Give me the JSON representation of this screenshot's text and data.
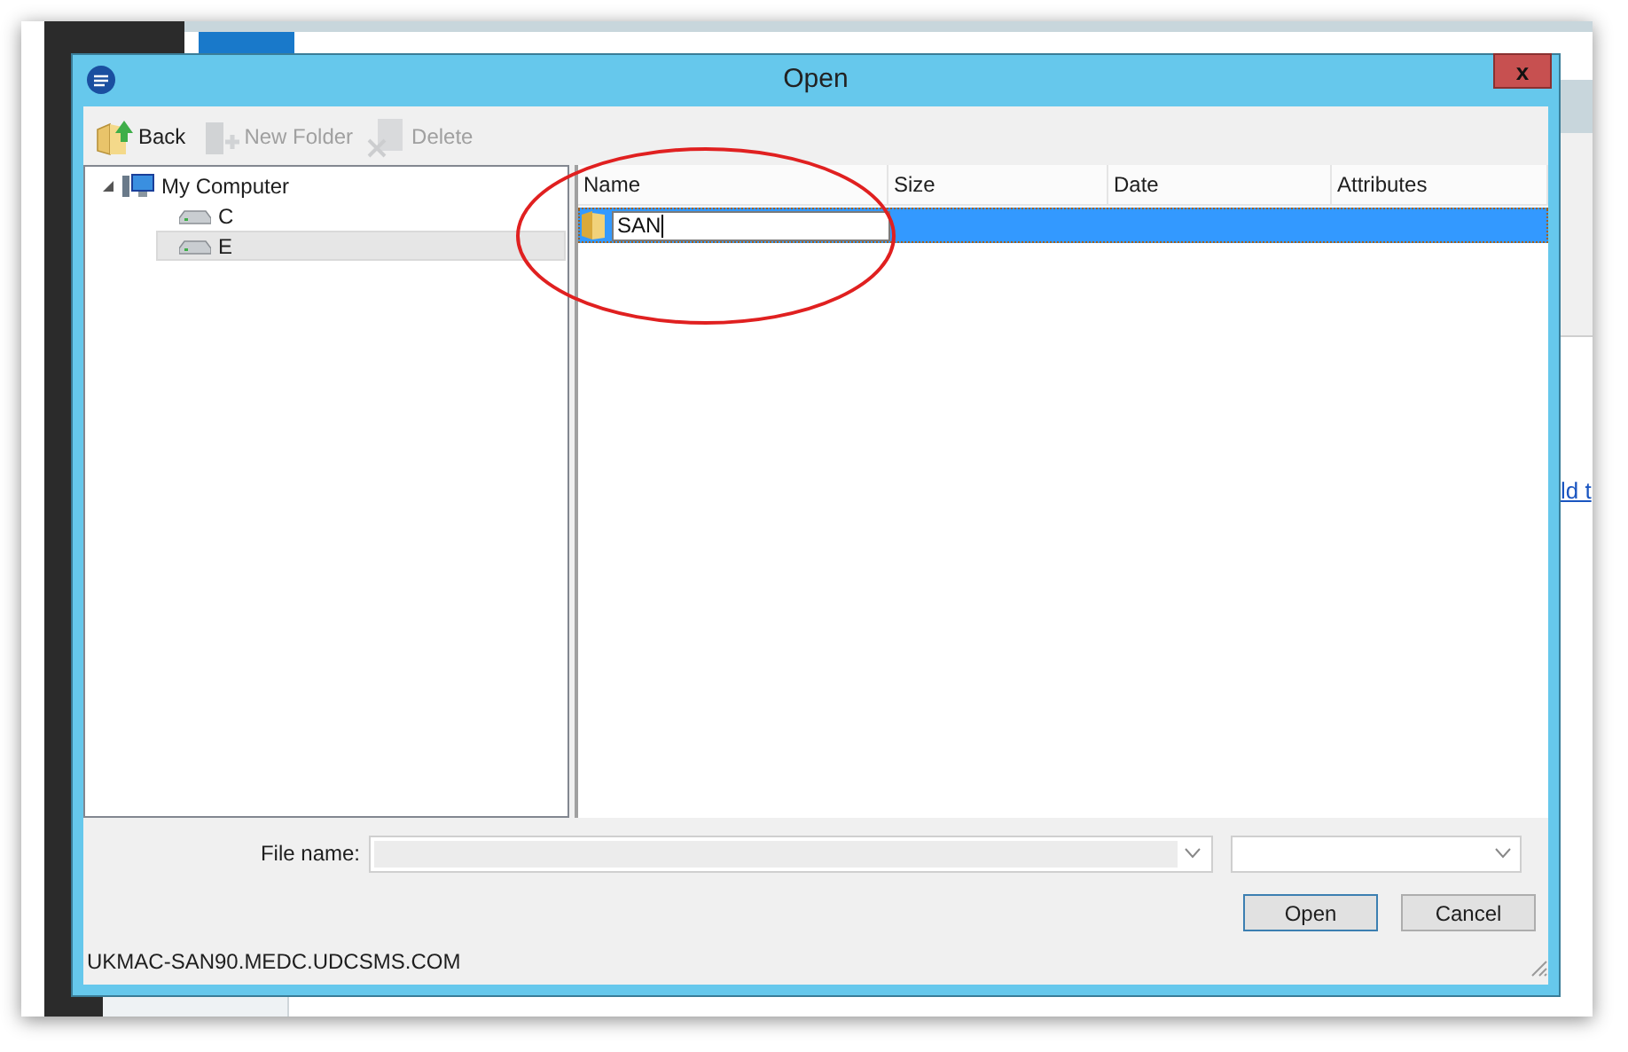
{
  "background": {
    "link": "ld t"
  },
  "dialog": {
    "title": "Open",
    "close_label": "x",
    "toolbar": [
      {
        "kind": "back",
        "label": "Back",
        "disabled": false
      },
      {
        "kind": "new-folder",
        "label": "New Folder",
        "disabled": true
      },
      {
        "kind": "delete",
        "label": "Delete",
        "disabled": true
      }
    ],
    "tree": [
      {
        "kind": "computer",
        "label": "My Computer",
        "expanded": true,
        "selected": false,
        "children": [
          {
            "kind": "drive",
            "label": "C",
            "selected": false
          },
          {
            "kind": "drive",
            "label": "E",
            "selected": true
          }
        ]
      }
    ],
    "columns": [
      "Name",
      "Size",
      "Date",
      "Attributes"
    ],
    "rows": [
      {
        "name": "SAN",
        "selected": true,
        "editing": true
      }
    ],
    "file_name_label": "File name:",
    "buttons": [
      {
        "label": "Open",
        "default": true
      },
      {
        "label": "Cancel",
        "default": false
      }
    ],
    "status": "UKMAC-SAN90.MEDC.UDCSMS.COM"
  }
}
